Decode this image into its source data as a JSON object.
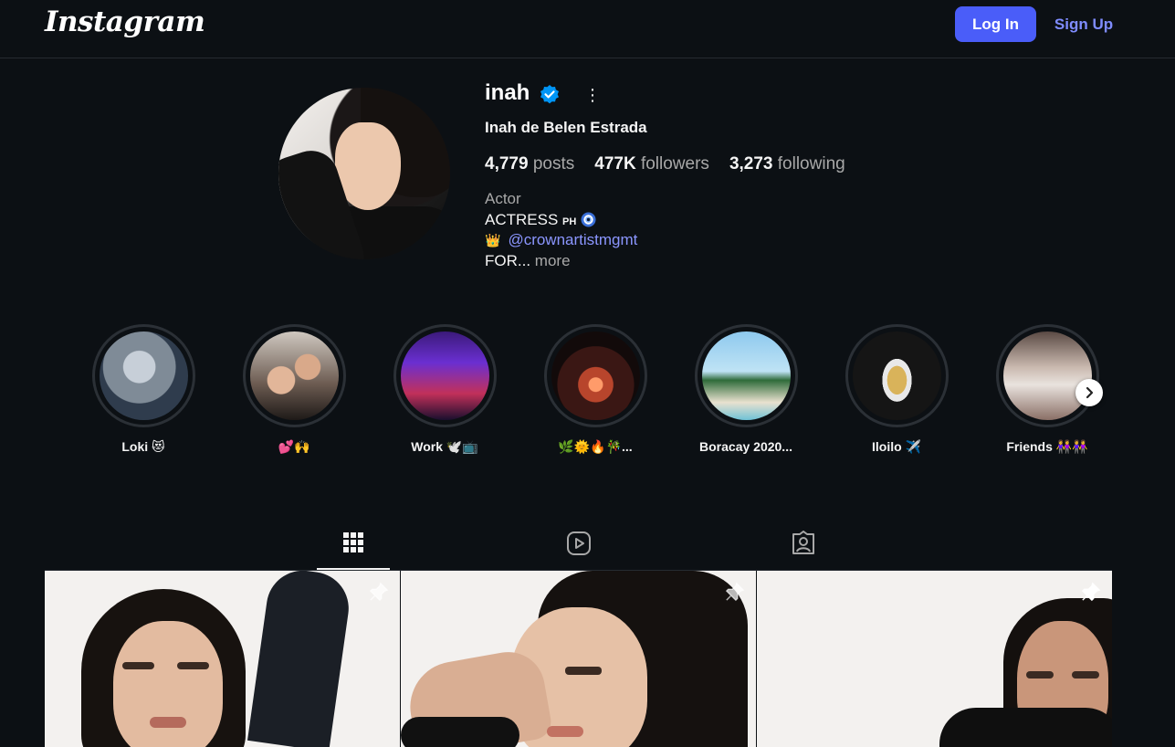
{
  "header": {
    "logo": "Instagram",
    "login_label": "Log In",
    "signup_label": "Sign Up"
  },
  "profile": {
    "username": "inah",
    "full_name": "Inah de Belen Estrada",
    "stats": {
      "posts_count": "4,779",
      "posts_label": "posts",
      "followers_count": "477K",
      "followers_label": "followers",
      "following_count": "3,273",
      "following_label": "following"
    },
    "category": "Actor",
    "bio": {
      "line1_text": "ACTRESS ",
      "line1_tag": "PH",
      "line2_mention": "@crownartistmgmt",
      "line3_text": "FOR...",
      "more_label": " more"
    }
  },
  "highlights": [
    {
      "label": "Loki 😻"
    },
    {
      "label": "💕🙌"
    },
    {
      "label": "Work 🕊️📺"
    },
    {
      "label": "🌿🌞🔥🎋..."
    },
    {
      "label": "Boracay 2020..."
    },
    {
      "label": "Iloilo ✈️"
    },
    {
      "label": "Friends 👭👭"
    }
  ],
  "tabs": [
    "posts-grid",
    "reels",
    "tagged"
  ],
  "colors": {
    "background": "#0c1014",
    "accent": "#4a5df9",
    "link": "#8b96ff",
    "verified": "#0095f6"
  }
}
